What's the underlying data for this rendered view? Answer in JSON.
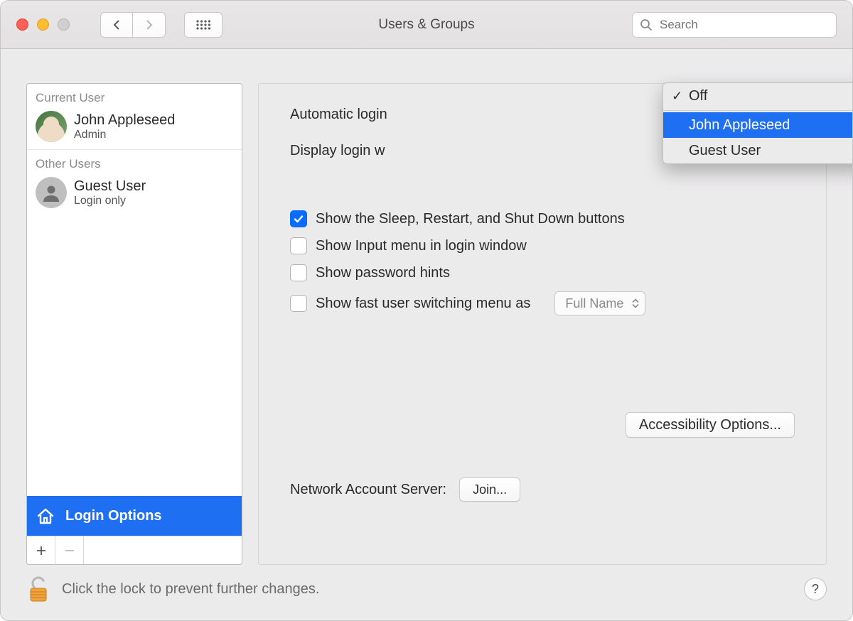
{
  "window": {
    "title": "Users & Groups"
  },
  "search": {
    "placeholder": "Search"
  },
  "sidebar": {
    "currentUserHeader": "Current User",
    "otherUsersHeader": "Other Users",
    "currentUser": {
      "name": "John Appleseed",
      "role": "Admin"
    },
    "otherUsers": [
      {
        "name": "Guest User",
        "role": "Login only"
      }
    ],
    "loginOptionsLabel": "Login Options"
  },
  "main": {
    "automaticLoginLabel": "Automatic login",
    "displayLoginLabel": "Display login w",
    "dropdown": {
      "options": [
        "Off",
        "John Appleseed",
        "Guest User"
      ],
      "checked": "Off",
      "highlighted": "John Appleseed"
    },
    "checkboxes": {
      "sleep": {
        "checked": true,
        "label": "Show the Sleep, Restart, and Shut Down buttons"
      },
      "input": {
        "checked": false,
        "label": "Show Input menu in login window"
      },
      "hints": {
        "checked": false,
        "label": "Show password hints"
      },
      "fast": {
        "checked": false,
        "label": "Show fast user switching menu as"
      }
    },
    "fastUserSelect": "Full Name",
    "accessibilityButton": "Accessibility Options...",
    "networkAccountLabel": "Network Account Server:",
    "joinButton": "Join..."
  },
  "footer": {
    "lockHint": "Click the lock to prevent further changes."
  }
}
